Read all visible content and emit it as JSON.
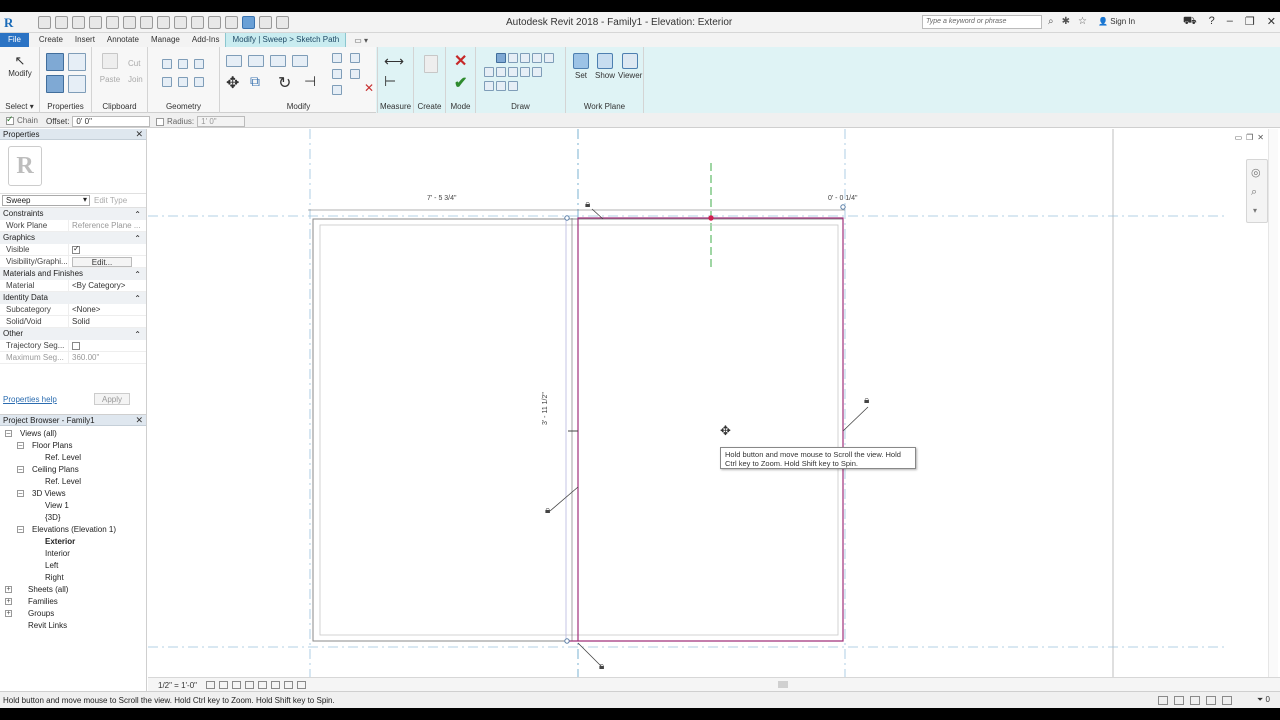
{
  "app": {
    "title": "Autodesk Revit 2018 -    Family1 - Elevation: Exterior",
    "logo": "R",
    "search_placeholder": "Type a keyword or phrase",
    "sign_in": "Sign In"
  },
  "tabs": [
    {
      "label": "File"
    },
    {
      "label": "Create"
    },
    {
      "label": "Insert"
    },
    {
      "label": "Annotate"
    },
    {
      "label": "Manage"
    },
    {
      "label": "Add-Ins"
    },
    {
      "label": "Modify | Sweep > Sketch Path"
    }
  ],
  "ribbon": {
    "modify_label": "Modify",
    "select_label": "Select",
    "panels": {
      "properties": "Properties",
      "clipboard": "Clipboard",
      "geometry": "Geometry",
      "modify": "Modify",
      "measure": "Measure",
      "create": "Create",
      "mode": "Mode",
      "draw": "Draw",
      "work_plane": "Work Plane"
    },
    "clipboard_items": {
      "paste": "Paste",
      "cut": "Cut",
      "join": "Join"
    },
    "work_plane_items": {
      "set": "Set",
      "show": "Show",
      "viewer": "Viewer"
    }
  },
  "options_bar": {
    "chain_label": "Chain",
    "offset_label": "Offset:",
    "offset_value": "0'  0\"",
    "radius_label": "Radius:",
    "radius_value": "1'  0\""
  },
  "properties": {
    "header": "Properties",
    "type_value": "Sweep",
    "edit_type": "Edit Type",
    "groups": {
      "constraints": "Constraints",
      "graphics": "Graphics",
      "materials": "Materials and Finishes",
      "identity": "Identity Data",
      "other": "Other"
    },
    "rows": {
      "work_plane": {
        "key": "Work Plane",
        "value": "Reference Plane ..."
      },
      "visible": {
        "key": "Visible"
      },
      "visibility": {
        "key": "Visibility/Graphi...",
        "value": "Edit..."
      },
      "material": {
        "key": "Material",
        "value": "<By Category>"
      },
      "subcategory": {
        "key": "Subcategory",
        "value": "<None>"
      },
      "solid_void": {
        "key": "Solid/Void",
        "value": "Solid"
      },
      "trajectory": {
        "key": "Trajectory Seg..."
      },
      "max_seg": {
        "key": "Maximum Seg...",
        "value": "360.00\""
      }
    },
    "help_link": "Properties help",
    "apply": "Apply"
  },
  "browser": {
    "header": "Project Browser - Family1",
    "nodes": {
      "views": "Views (all)",
      "floor_plans": "Floor Plans",
      "fp_ref": "Ref. Level",
      "ceiling_plans": "Ceiling Plans",
      "cp_ref": "Ref. Level",
      "views3d": "3D Views",
      "view1": "View 1",
      "v3d": "{3D}",
      "elevations": "Elevations (Elevation 1)",
      "exterior": "Exterior",
      "interior": "Interior",
      "left": "Left",
      "right": "Right",
      "sheets": "Sheets (all)",
      "families": "Families",
      "groups": "Groups",
      "revit_links": "Revit Links"
    }
  },
  "canvas": {
    "dim_top_left": "7' - 5 3/4\"",
    "dim_top_right": "0' - 0 1/4\"",
    "dim_vertical": "3' - 11 1/2\"",
    "tooltip": "Hold button and move mouse to Scroll the view. Hold Ctrl key to Zoom. Hold Shift key to Spin."
  },
  "view_control": {
    "scale": "1/2\" = 1'-0\""
  },
  "status": {
    "message": "Hold button and move mouse to Scroll the view. Hold Ctrl key to Zoom. Hold Shift key to Spin.",
    "filter": "0"
  },
  "colors": {
    "accent": "#2b73c4",
    "context_tab": "#c9ecf0",
    "sketch_line": "#a0307a",
    "ref_plane": "#5aa0c8"
  }
}
